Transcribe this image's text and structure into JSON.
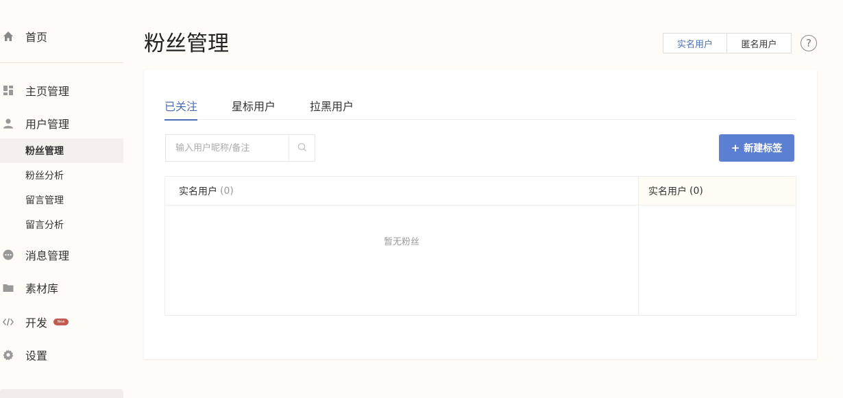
{
  "sidebar": {
    "home": {
      "label": "首页",
      "icon": "home-icon"
    },
    "items": [
      {
        "label": "主页管理",
        "icon": "dashboard-icon"
      },
      {
        "label": "用户管理",
        "icon": "user-icon"
      },
      {
        "label": "消息管理",
        "icon": "message-icon"
      },
      {
        "label": "素材库",
        "icon": "folder-icon"
      },
      {
        "label": "开发",
        "icon": "code-icon",
        "badge": "New"
      },
      {
        "label": "设置",
        "icon": "gear-icon"
      }
    ],
    "sub_items": [
      {
        "label": "粉丝管理",
        "active": true
      },
      {
        "label": "粉丝分析",
        "active": false
      },
      {
        "label": "留言管理",
        "active": false
      },
      {
        "label": "留言分析",
        "active": false
      }
    ]
  },
  "header": {
    "title": "粉丝管理",
    "switch": [
      "实名用户",
      "匿名用户"
    ],
    "help": "?"
  },
  "tabs": [
    "已关注",
    "星标用户",
    "拉黑用户"
  ],
  "search": {
    "placeholder": "输入用户昵称/备注"
  },
  "new_tag_button": {
    "plus": "+",
    "label": "新建标签"
  },
  "list": {
    "header_label": "实名用户",
    "header_count": "(0)",
    "empty_text": "暂无粉丝"
  },
  "tag_panel": {
    "header_label": "实名用户",
    "header_count": "(0)"
  },
  "colors": {
    "accent": "#4a6fb5",
    "button": "#5b7fd1",
    "background": "#fffcf7",
    "badge": "#c25a4e"
  }
}
